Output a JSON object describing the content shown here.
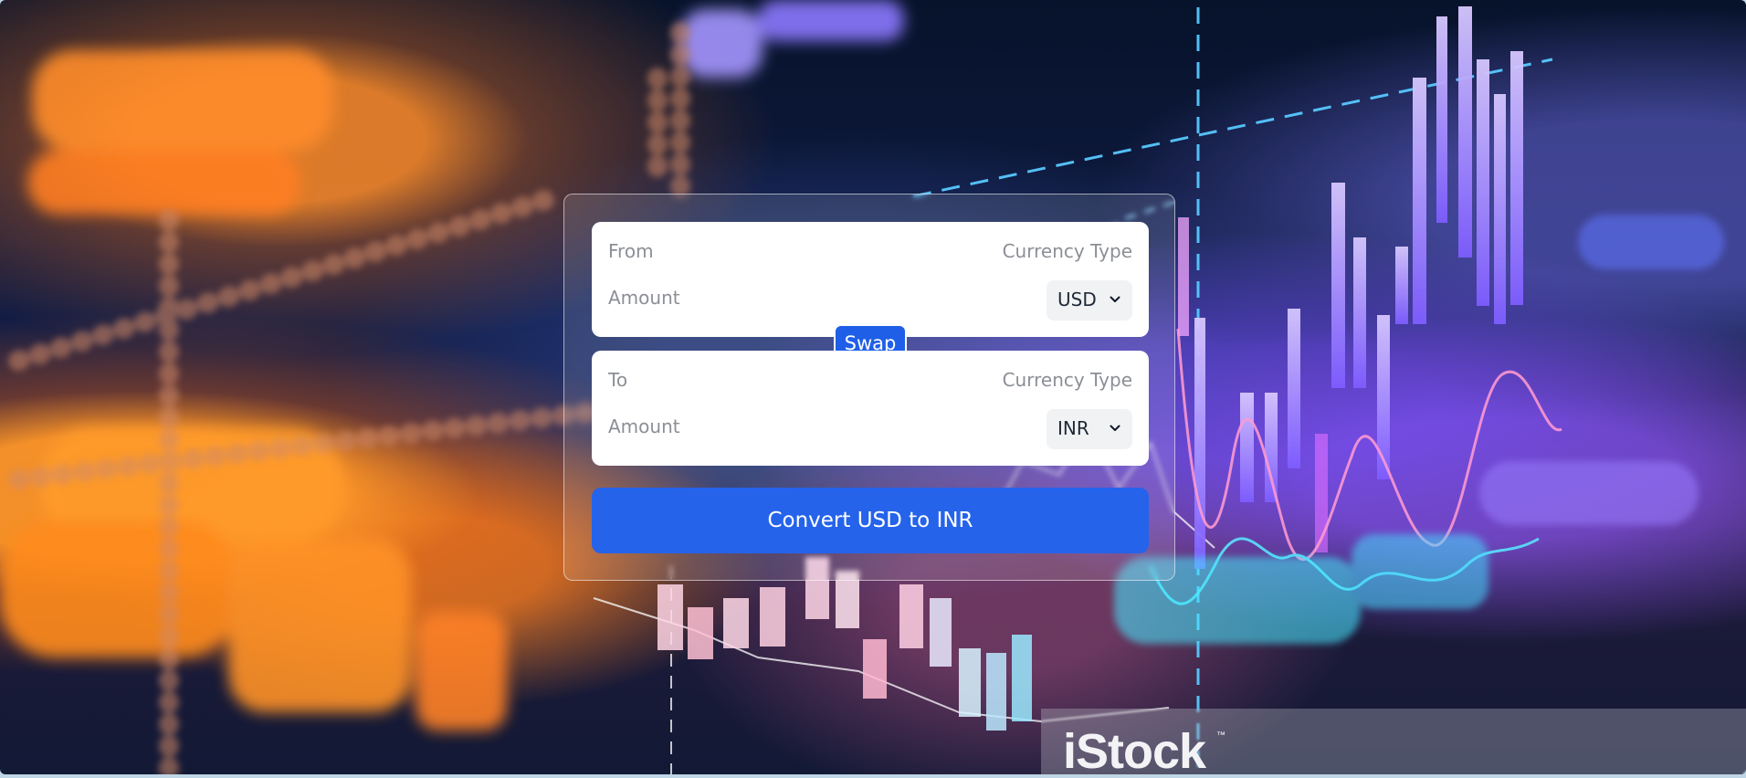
{
  "converter": {
    "from": {
      "label": "From",
      "amount_placeholder": "Amount",
      "currency_type_label": "Currency Type",
      "selected_currency": "USD"
    },
    "swap_label": "Swap",
    "to": {
      "label": "To",
      "amount_placeholder": "Amount",
      "currency_type_label": "Currency Type",
      "selected_currency": "INR"
    },
    "convert_label": "Convert USD to INR"
  },
  "watermark": {
    "text": "iStock",
    "trademark": "™"
  },
  "colors": {
    "primary": "#2563eb",
    "swap": "#1f5fe8",
    "muted_text": "#8b8f96",
    "panel": "#ffffff"
  },
  "icons": {
    "select_arrow": "chevron-down-icon"
  }
}
